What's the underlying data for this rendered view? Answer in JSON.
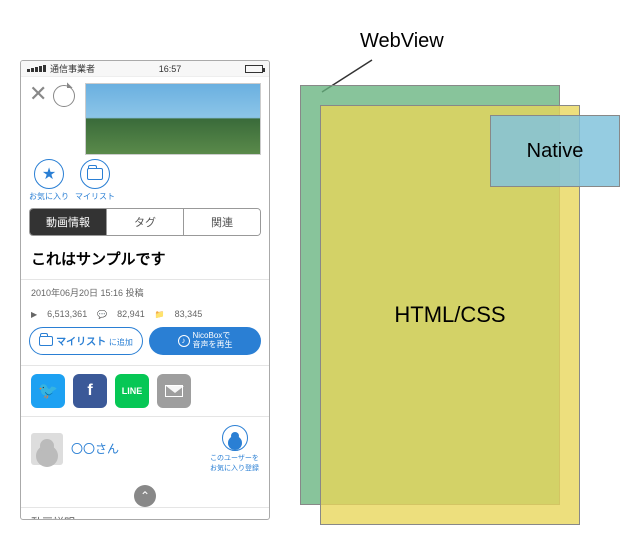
{
  "statusbar": {
    "carrier": "通信事業者",
    "time": "16:57"
  },
  "icon_buttons": {
    "favorite": "お気に入り",
    "mylist": "マイリスト"
  },
  "tabs": {
    "info": "動画情報",
    "tag": "タグ",
    "related": "関連"
  },
  "video": {
    "title": "これはサンプルです",
    "posted": "2010年06月20日 15:16 投稿",
    "views": "6,513,361",
    "comments": "82,941",
    "mylist_count": "83,345"
  },
  "pill": {
    "add_mylist_pre": "マイリスト",
    "add_mylist_suf": "に追加",
    "nicobox_l1": "NicoBoxで",
    "nicobox_l2": "音声を再生"
  },
  "share": {
    "line": "LINE"
  },
  "user": {
    "name": "〇〇さん",
    "follow_l1": "このユーザーを",
    "follow_l2": "お気に入り登録"
  },
  "description_header": "動画説明",
  "diagram": {
    "webview": "WebView",
    "native": "Native",
    "htmlcss": "HTML/CSS"
  }
}
